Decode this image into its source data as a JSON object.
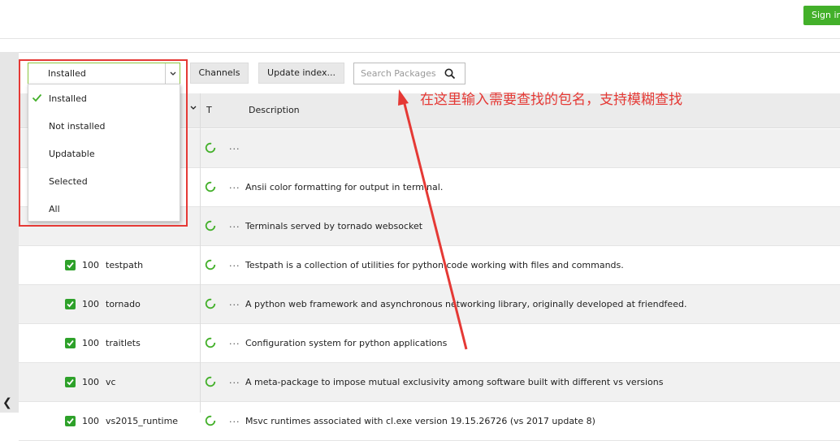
{
  "header": {
    "signin_label": "Sign in"
  },
  "toolbar": {
    "filter_value": "Installed",
    "channels_label": "Channels",
    "update_index_label": "Update index...",
    "search_placeholder": "Search Packages"
  },
  "filter_menu": {
    "options": [
      "Installed",
      "Not installed",
      "Updatable",
      "Selected",
      "All"
    ],
    "selected": "Installed"
  },
  "table": {
    "columns": {
      "t": "T",
      "description": "Description"
    },
    "rows": [
      {
        "version": "",
        "name": "",
        "ellipsis": "...",
        "description": ""
      },
      {
        "version": "",
        "name": "",
        "ellipsis": "...",
        "description": "Ansii color formatting for output in terminal."
      },
      {
        "version": "",
        "name": "",
        "ellipsis": "...",
        "description": "Terminals served by tornado websocket"
      },
      {
        "version": "100",
        "name": "testpath",
        "ellipsis": "...",
        "description": "Testpath is a collection of utilities for python code working with files and commands."
      },
      {
        "version": "100",
        "name": "tornado",
        "ellipsis": "...",
        "description": "A python web framework and asynchronous networking library, originally developed at friendfeed."
      },
      {
        "version": "100",
        "name": "traitlets",
        "ellipsis": "...",
        "description": "Configuration system for python applications"
      },
      {
        "version": "100",
        "name": "vc",
        "ellipsis": "...",
        "description": "A meta-package to impose mutual exclusivity among software built with different vs versions"
      },
      {
        "version": "100",
        "name": "vs2015_runtime",
        "ellipsis": "...",
        "description": "Msvc runtimes associated with cl.exe version 19.15.26726 (vs 2017 update 8)"
      }
    ]
  },
  "annotation": {
    "text": "在这里输入需要查找的包名，支持模糊查找"
  },
  "colors": {
    "accent_green": "#43b02a",
    "checkbox_green": "#2ea12a",
    "annotation_red": "#e53935"
  }
}
